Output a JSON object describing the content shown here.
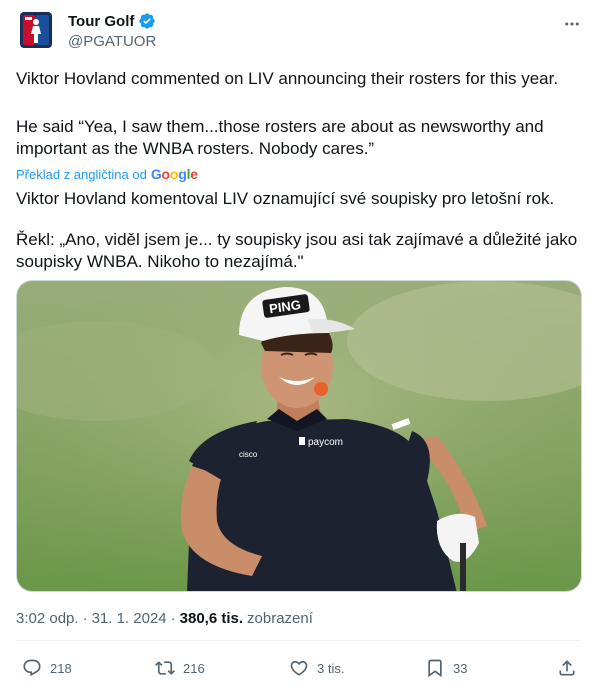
{
  "author": {
    "display_name": "Tour Golf",
    "handle": "@PGATUOR",
    "avatar_icon": "pga-tour-logo",
    "verified_icon": "verified-badge-icon"
  },
  "tweet": {
    "text_en_1": "Viktor Hovland commented on LIV announcing their rosters for this year.",
    "text_en_2": "He said “Yea, I saw them...those rosters are about as newsworthy and important as the WNBA rosters. Nobody cares.”",
    "translate_label": "Překlad z angličtina od",
    "translate_provider": "Google",
    "text_cs_1": "Viktor Hovland komentoval LIV oznamující své soupisky pro letošní rok.",
    "text_cs_2": "Řekl: „Ano, viděl jsem je... ty soupisky jsou asi tak zajímavé a důležité jako soupisky WNBA. Nikoho to nezajímá.\"",
    "media_alt": ""
  },
  "meta": {
    "time": "3:02 odp.",
    "separator": "·",
    "date": "31. 1. 2024",
    "views_count": "380,6 tis.",
    "views_label": "zobrazení"
  },
  "actions": {
    "replies": "218",
    "retweets": "216",
    "likes": "3 tis.",
    "bookmarks": "33"
  },
  "colors": {
    "accent": "#1d9bf0",
    "text_primary": "#0f1419",
    "text_secondary": "#536471"
  }
}
